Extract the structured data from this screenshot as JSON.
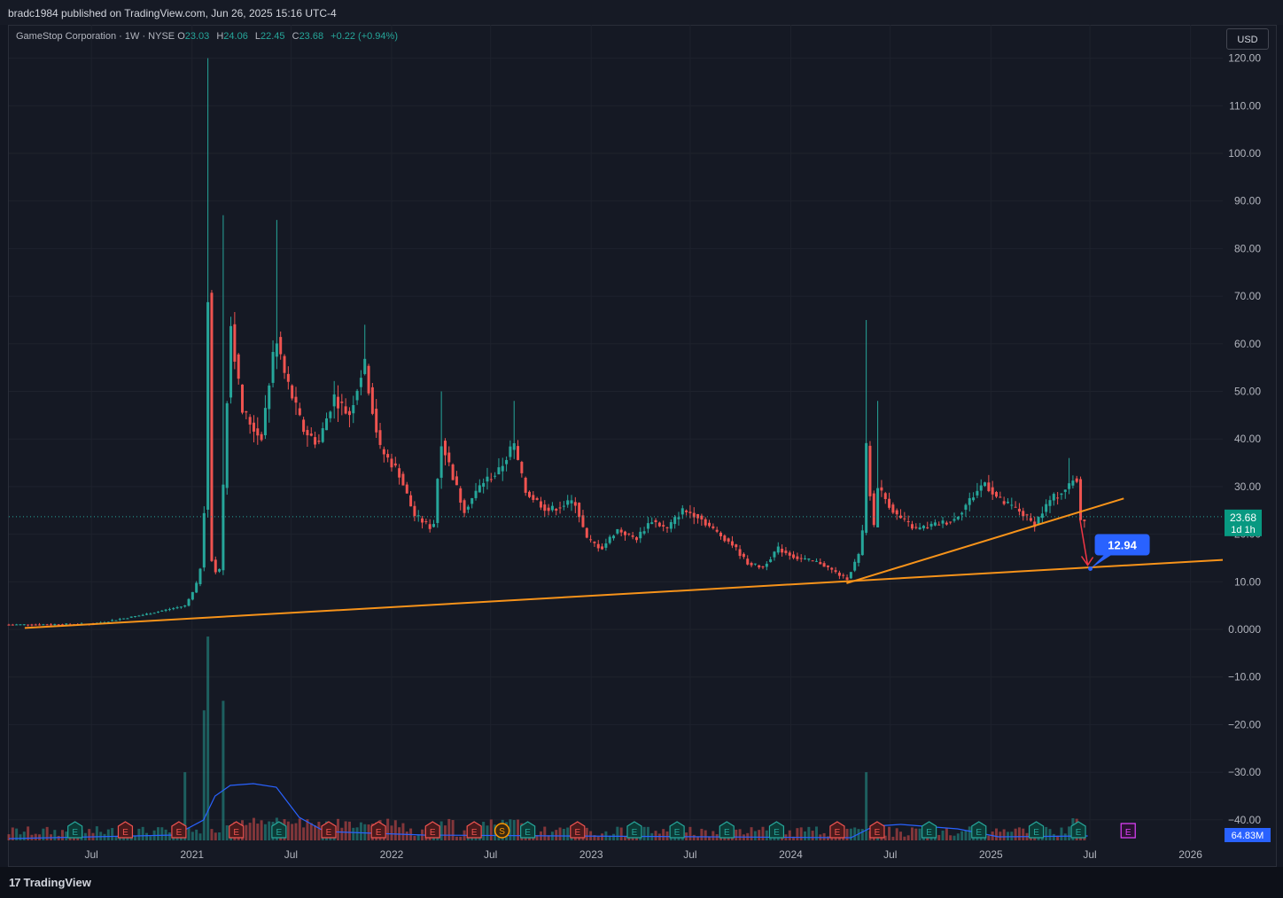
{
  "header": {
    "published_by": "bradc1984 published on TradingView.com, Jun 26, 2025 15:16 UTC-4"
  },
  "symbol": {
    "name": "GameStop Corporation · 1W · NYSE",
    "open_label": "O",
    "open": "23.03",
    "high_label": "H",
    "high": "24.06",
    "low_label": "L",
    "low": "22.45",
    "close_label": "C",
    "close": "23.68",
    "change": "+0.22 (+0.94%)"
  },
  "currency_button": "USD",
  "price_badge": {
    "price": "23.68",
    "countdown": "1d 1h"
  },
  "target_badge": "12.94",
  "volume_badge": "64.83M",
  "footer": {
    "brand": "TradingView"
  },
  "colors": {
    "up": "#26a69a",
    "down": "#ef5350",
    "trendline": "#f7931a",
    "volume_ma": "#2962ff",
    "background": "#131722"
  },
  "chart_data": {
    "type": "candlestick",
    "title": "GameStop Corporation · 1W · NYSE",
    "y_ticks": [
      "120.00",
      "110.00",
      "100.00",
      "90.00",
      "80.00",
      "70.00",
      "60.00",
      "50.00",
      "40.00",
      "30.00",
      "20.00",
      "10.00",
      "0.0000",
      "−10.00",
      "−20.00",
      "−30.00",
      "−40.00"
    ],
    "y_tick_values": [
      120,
      110,
      100,
      90,
      80,
      70,
      60,
      50,
      40,
      30,
      20,
      10,
      0,
      -10,
      -20,
      -30,
      -40
    ],
    "ylim": [
      -45,
      123
    ],
    "x_ticks": [
      "Jul",
      "2021",
      "Jul",
      "2022",
      "Jul",
      "2023",
      "Jul",
      "2024",
      "Jul",
      "2025",
      "Jul",
      "2026"
    ],
    "x_tick_dates": [
      "2020-07-01",
      "2021-01-01",
      "2021-07-01",
      "2022-01-01",
      "2022-07-01",
      "2023-01-01",
      "2023-07-01",
      "2024-01-01",
      "2024-07-01",
      "2025-01-01",
      "2025-07-01",
      "2026-01-01"
    ],
    "last_price": 23.68,
    "price_path": [
      [
        "2020-02-01",
        1.0
      ],
      [
        "2020-07-01",
        1.1
      ],
      [
        "2020-10-01",
        3.0
      ],
      [
        "2020-12-20",
        5.0
      ],
      [
        "2021-01-08",
        9.0
      ],
      [
        "2021-01-22",
        16.0
      ],
      [
        "2021-01-29",
        80.0
      ],
      [
        "2021-02-05",
        15.0
      ],
      [
        "2021-02-19",
        10.0
      ],
      [
        "2021-02-26",
        27.0
      ],
      [
        "2021-03-12",
        65.0
      ],
      [
        "2021-04-02",
        46.0
      ],
      [
        "2021-05-07",
        40.0
      ],
      [
        "2021-06-04",
        62.0
      ],
      [
        "2021-06-18",
        54.0
      ],
      [
        "2021-07-23",
        42.0
      ],
      [
        "2021-08-20",
        39.0
      ],
      [
        "2021-09-17",
        49.0
      ],
      [
        "2021-10-15",
        45.0
      ],
      [
        "2021-11-12",
        56.0
      ],
      [
        "2021-12-10",
        38.0
      ],
      [
        "2022-01-14",
        33.0
      ],
      [
        "2022-02-11",
        24.0
      ],
      [
        "2022-03-18",
        21.0
      ],
      [
        "2022-04-01",
        40.0
      ],
      [
        "2022-05-13",
        25.0
      ],
      [
        "2022-06-17",
        31.0
      ],
      [
        "2022-07-15",
        33.0
      ],
      [
        "2022-08-12",
        39.0
      ],
      [
        "2022-09-02",
        29.0
      ],
      [
        "2022-10-14",
        25.0
      ],
      [
        "2022-12-02",
        27.0
      ],
      [
        "2022-12-23",
        19.0
      ],
      [
        "2023-01-20",
        17.0
      ],
      [
        "2023-02-17",
        21.0
      ],
      [
        "2023-03-24",
        19.0
      ],
      [
        "2023-04-21",
        23.0
      ],
      [
        "2023-05-19",
        21.0
      ],
      [
        "2023-06-16",
        25.0
      ],
      [
        "2023-07-14",
        24.0
      ],
      [
        "2023-08-11",
        21.0
      ],
      [
        "2023-09-15",
        18.0
      ],
      [
        "2023-10-13",
        14.0
      ],
      [
        "2023-11-10",
        13.0
      ],
      [
        "2023-12-08",
        17.0
      ],
      [
        "2024-01-12",
        15.0
      ],
      [
        "2024-02-23",
        14.0
      ],
      [
        "2024-04-12",
        10.5
      ],
      [
        "2024-05-10",
        17.0
      ],
      [
        "2024-05-17",
        40.0
      ],
      [
        "2024-05-31",
        20.0
      ],
      [
        "2024-06-07",
        30.0
      ],
      [
        "2024-07-12",
        24.0
      ],
      [
        "2024-08-16",
        21.0
      ],
      [
        "2024-09-20",
        22.0
      ],
      [
        "2024-10-25",
        23.0
      ],
      [
        "2024-11-29",
        28.0
      ],
      [
        "2024-12-20",
        31.0
      ],
      [
        "2025-01-17",
        27.0
      ],
      [
        "2025-02-21",
        25.0
      ],
      [
        "2025-03-21",
        22.0
      ],
      [
        "2025-04-18",
        27.0
      ],
      [
        "2025-05-23",
        30.0
      ],
      [
        "2025-06-06",
        33.0
      ],
      [
        "2025-06-13",
        23.0
      ],
      [
        "2025-06-27",
        23.68
      ]
    ],
    "wick_highs": [
      [
        "2021-01-29",
        120.0
      ],
      [
        "2021-02-26",
        87.0
      ],
      [
        "2021-06-04",
        86.0
      ],
      [
        "2021-11-12",
        64.0
      ],
      [
        "2022-04-01",
        50.0
      ],
      [
        "2022-08-12",
        48.0
      ],
      [
        "2024-05-17",
        65.0
      ],
      [
        "2024-06-07",
        48.0
      ],
      [
        "2025-05-23",
        36.0
      ]
    ],
    "volume_spikes": [
      [
        "2020-12-20",
        -30.0
      ],
      [
        "2021-01-22",
        -17.0
      ],
      [
        "2021-01-29",
        -1.5
      ],
      [
        "2021-02-26",
        -15.0
      ],
      [
        "2024-05-17",
        -30.0
      ]
    ],
    "trendlines": [
      {
        "from": [
          "2020-03-01",
          0.3
        ],
        "to": [
          "2026-03-01",
          14.6
        ]
      },
      {
        "from": [
          "2024-04-12",
          9.7
        ],
        "to": [
          "2025-09-01",
          27.5
        ]
      }
    ],
    "projection": {
      "from": [
        "2025-06-13",
        23.0
      ],
      "to": [
        "2025-06-27",
        13.5
      ]
    },
    "target_point": [
      "2025-06-27",
      12.94
    ],
    "earnings_markers": [
      [
        "2020-06-01",
        "E",
        "up"
      ],
      [
        "2020-09-01",
        "E",
        "down"
      ],
      [
        "2020-12-08",
        "E",
        "down"
      ],
      [
        "2021-03-23",
        "E",
        "down"
      ],
      [
        "2021-06-09",
        "E",
        "up"
      ],
      [
        "2021-09-08",
        "E",
        "down"
      ],
      [
        "2021-12-08",
        "E",
        "down"
      ],
      [
        "2022-03-17",
        "E",
        "down"
      ],
      [
        "2022-06-01",
        "E",
        "down"
      ],
      [
        "2022-07-22",
        "S",
        "split"
      ],
      [
        "2022-09-07",
        "E",
        "up"
      ],
      [
        "2022-12-07",
        "E",
        "down"
      ],
      [
        "2023-03-21",
        "E",
        "up"
      ],
      [
        "2023-06-07",
        "E",
        "up"
      ],
      [
        "2023-09-06",
        "E",
        "up"
      ],
      [
        "2023-12-06",
        "E",
        "up"
      ],
      [
        "2024-03-26",
        "E",
        "down"
      ],
      [
        "2024-06-07",
        "E",
        "down"
      ],
      [
        "2024-09-10",
        "E",
        "up"
      ],
      [
        "2024-12-10",
        "E",
        "up"
      ],
      [
        "2025-03-25",
        "E",
        "up"
      ],
      [
        "2025-06-10",
        "E",
        "up"
      ],
      [
        "2025-09-09",
        "E",
        "upcoming"
      ]
    ]
  }
}
